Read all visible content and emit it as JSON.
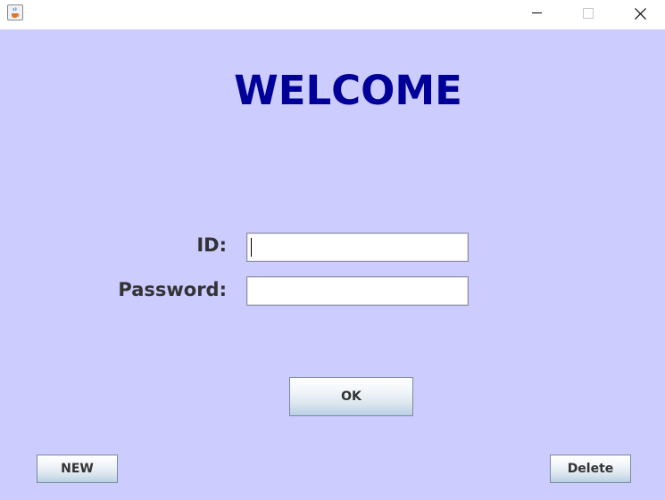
{
  "titlebar": {
    "icons": {
      "app": "java-cup-icon",
      "minimize": "minimize-icon",
      "maximize": "maximize-icon",
      "close": "close-icon"
    }
  },
  "content": {
    "background": "#ccccff",
    "title": "WELCOME",
    "title_color": "#000099"
  },
  "form": {
    "id_label": "ID:",
    "id_value": "",
    "password_label": "Password:",
    "password_value": ""
  },
  "buttons": {
    "ok": "OK",
    "new": "NEW",
    "delete": "Delete"
  }
}
